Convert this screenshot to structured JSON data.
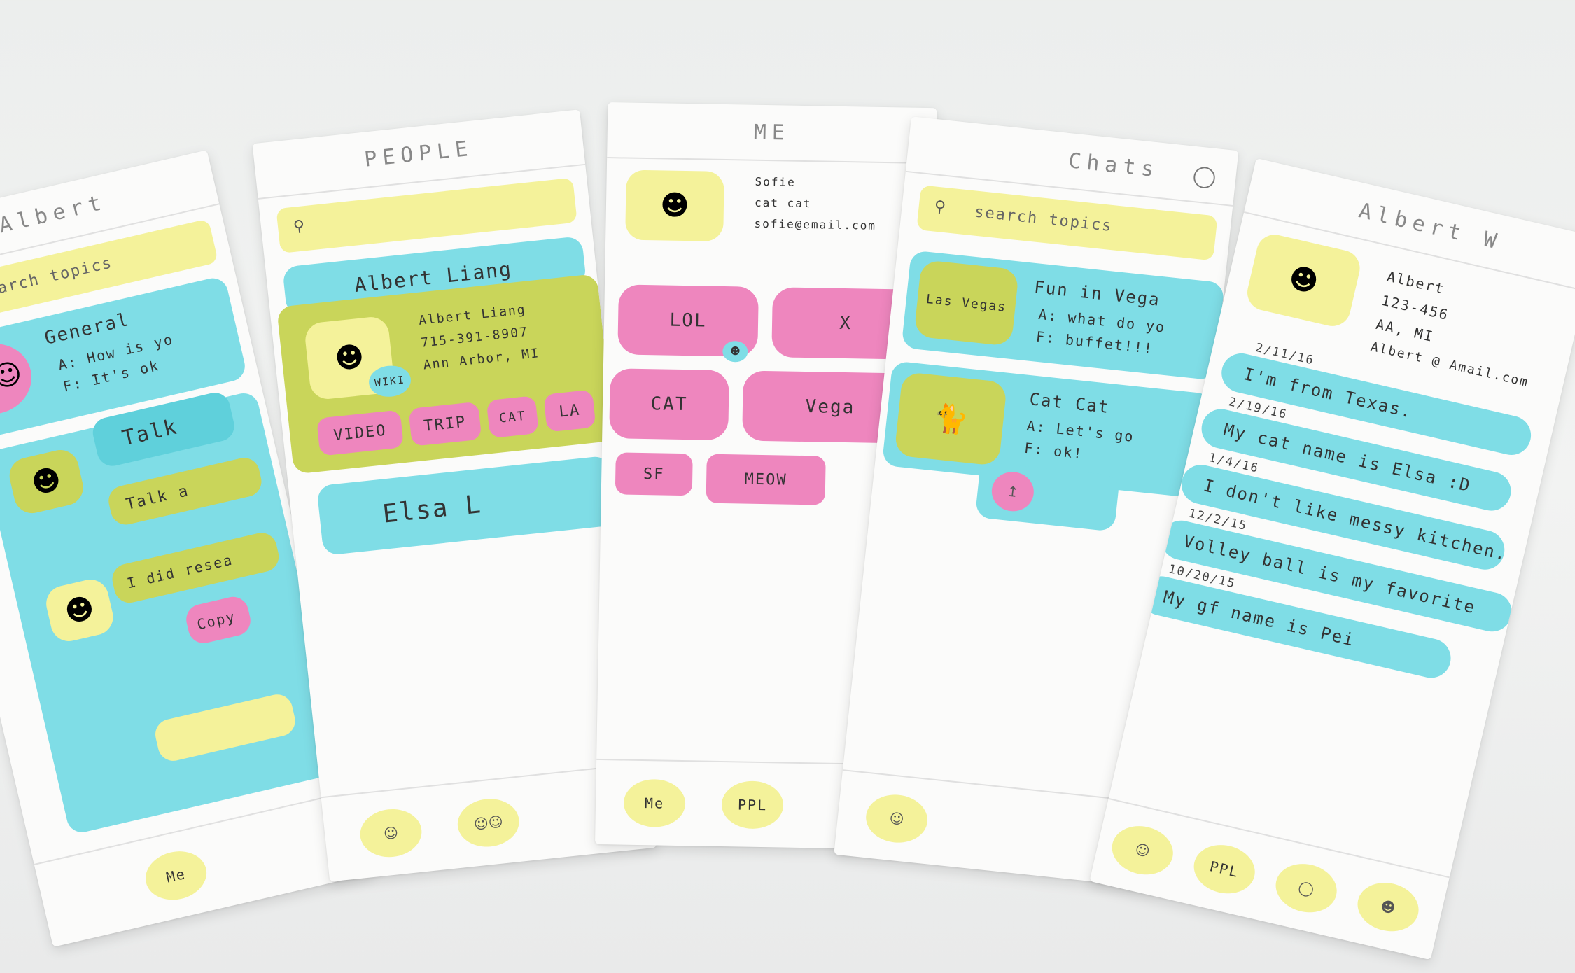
{
  "screens": {
    "albert_topics": {
      "title": "Albert",
      "search_placeholder": "search   topics",
      "topic_title": "General",
      "topic_line_a": "A: How is yo",
      "topic_line_f": "F: It's ok",
      "talk_label": "Talk",
      "bubble_1": "Talk a",
      "bubble_2": "I did resea",
      "bubble_3": "Copy",
      "nav_me": "Me"
    },
    "people": {
      "title": "PEOPLE",
      "contact_header": "Albert  Liang",
      "contact_name": "Albert  Liang",
      "contact_phone": "715-391-8907",
      "contact_location": "Ann Arbor, MI",
      "wiki_label": "WIKI",
      "tags": [
        "VIDEO",
        "TRIP",
        "CAT",
        "LA"
      ],
      "second_contact": "Elsa  L"
    },
    "me": {
      "title": "ME",
      "profile_lines": [
        "Sofie",
        "cat cat",
        "sofie@email.com"
      ],
      "interests": [
        "LOL",
        "X",
        "CAT",
        "Vega",
        "SF",
        "MEOW"
      ],
      "nav_me": "Me",
      "nav_ppl": "PPL"
    },
    "chats": {
      "title": "Chats",
      "search_placeholder": "search    topics",
      "chat_1_title": "Fun  in  Vega",
      "chat_1_a": "A: what do yo",
      "chat_1_f": "F: buffet!!!",
      "chat_1_sticker": "Las Vegas",
      "chat_2_title": "Cat  Cat",
      "chat_2_a": "A: Let's go",
      "chat_2_f": "F: ok!"
    },
    "profile": {
      "title": "Albert  W",
      "name": "Albert",
      "phone": "123-456",
      "location": "AA, MI",
      "email": "Albert @ Amail.com",
      "facts": [
        {
          "date": "2/11/16",
          "text": "I'm  from  Texas."
        },
        {
          "date": "2/19/16",
          "text": "My  cat  name  is  Elsa :D"
        },
        {
          "date": "1/4/16",
          "text": "I don't  like  messy  kitchen."
        },
        {
          "date": "12/2/15",
          "text": "Volley ball  is  my  favorite"
        },
        {
          "date": "10/20/15",
          "text": "My gf  name  is  Pei"
        }
      ],
      "nav_labels": [
        "",
        "PPL",
        "",
        ""
      ]
    }
  },
  "colors": {
    "yellow": "#f4f29a",
    "cyan": "#7fdde6",
    "pink": "#ee86be",
    "olive": "#c9d55a",
    "paper": "#fbfbfa"
  }
}
